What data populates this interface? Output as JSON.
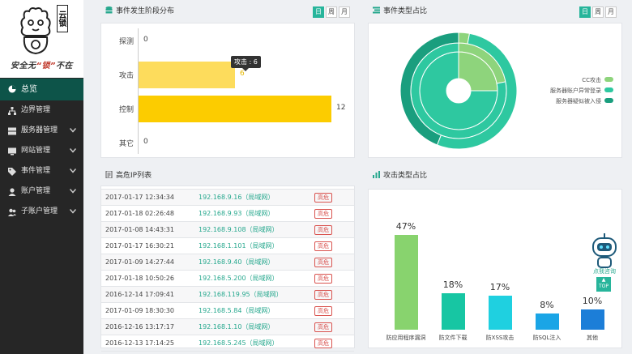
{
  "brand": {
    "logo_vertical": "云锁",
    "slogan_prefix": "安全无",
    "slogan_highlight": "“锁”",
    "slogan_suffix": "不在"
  },
  "sidebar": {
    "items": [
      {
        "label": "总览",
        "icon": "pie-chart-icon",
        "active": true,
        "has_submenu": false
      },
      {
        "label": "边界管理",
        "icon": "sitemap-icon",
        "has_submenu": false
      },
      {
        "label": "服务器管理",
        "icon": "server-icon",
        "has_submenu": true
      },
      {
        "label": "网站管理",
        "icon": "monitor-icon",
        "has_submenu": true
      },
      {
        "label": "事件管理",
        "icon": "tag-icon",
        "has_submenu": true
      },
      {
        "label": "账户管理",
        "icon": "user-icon",
        "has_submenu": true
      },
      {
        "label": "子账户管理",
        "icon": "users-icon",
        "has_submenu": true
      }
    ]
  },
  "stage_panel": {
    "title": "事件发生阶段分布",
    "tabs": [
      "日",
      "周",
      "月"
    ],
    "active_tab": "日",
    "tooltip": "攻击 : 6"
  },
  "type_share_panel": {
    "title": "事件类型占比",
    "tabs": [
      "日",
      "周",
      "月"
    ],
    "active_tab": "日",
    "legend": [
      {
        "label": "CC攻击",
        "color": "#8ed47c"
      },
      {
        "label": "服务器账户异常登录",
        "color": "#2ec8a0"
      },
      {
        "label": "服务器疑似被入侵",
        "color": "#1a9e7e"
      }
    ]
  },
  "ip_panel": {
    "title": "高危IP列表",
    "rows": [
      {
        "time": "2017-01-17 12:34:34",
        "ip": "192.168.9.16（局域网）",
        "level": "高危"
      },
      {
        "time": "2017-01-18 02:26:48",
        "ip": "192.168.9.93（局域网）",
        "level": "高危"
      },
      {
        "time": "2017-01-08 14:43:31",
        "ip": "192.168.9.108（局域网）",
        "level": "高危"
      },
      {
        "time": "2017-01-17 16:30:21",
        "ip": "192.168.1.101（局域网）",
        "level": "高危"
      },
      {
        "time": "2017-01-09 14:27:44",
        "ip": "192.168.9.40（局域网）",
        "level": "高危"
      },
      {
        "time": "2017-01-18 10:50:26",
        "ip": "192.168.5.200（局域网）",
        "level": "高危"
      },
      {
        "time": "2016-12-14 17:09:41",
        "ip": "192.168.119.95（局域网）",
        "level": "高危"
      },
      {
        "time": "2017-01-09 18:30:30",
        "ip": "192.168.5.84（局域网）",
        "level": "高危"
      },
      {
        "time": "2016-12-16 13:17:17",
        "ip": "192.168.1.10（局域网）",
        "level": "高危"
      },
      {
        "time": "2016-12-13 17:14:25",
        "ip": "192.168.5.245（局域网）",
        "level": "高危"
      }
    ]
  },
  "attack_panel": {
    "title": "攻击类型占比"
  },
  "assistant": {
    "label": "点我咨询",
    "top_label": "TOP"
  },
  "chart_data": [
    {
      "type": "bar",
      "orientation": "horizontal",
      "categories": [
        "探测",
        "攻击",
        "控制",
        "其它"
      ],
      "values": [
        0,
        6,
        12,
        0
      ],
      "colors": [
        "#fddc5c",
        "#fddc5c",
        "#fccc00",
        "#fddc5c"
      ],
      "xlim": [
        0,
        12
      ]
    },
    {
      "type": "pie",
      "style": "nested-donut",
      "labels": [
        "CC攻击",
        "服务器账户异常登录",
        "服务器疑似被入侵"
      ],
      "colors": [
        "#8ed47c",
        "#2ec8a0",
        "#1a9e7e"
      ],
      "rings": [
        {
          "ring": "inner",
          "values": [
            25,
            75
          ]
        },
        {
          "ring": "middle",
          "values": [
            22,
            78
          ]
        },
        {
          "ring": "outer",
          "values": [
            3,
            53,
            44
          ]
        }
      ]
    },
    {
      "type": "bar",
      "categories": [
        "防应用程序漏洞",
        "防文件下载",
        "防XSS攻击",
        "防SQL注入",
        "其他"
      ],
      "values": [
        47,
        18,
        17,
        8,
        10
      ],
      "labels": [
        "47%",
        "18%",
        "17%",
        "8%",
        "10%"
      ],
      "colors": [
        "#88d36e",
        "#17c6a3",
        "#1fd0e0",
        "#1aa5e6",
        "#1c7ed8"
      ],
      "ylim": [
        0,
        50
      ]
    }
  ]
}
